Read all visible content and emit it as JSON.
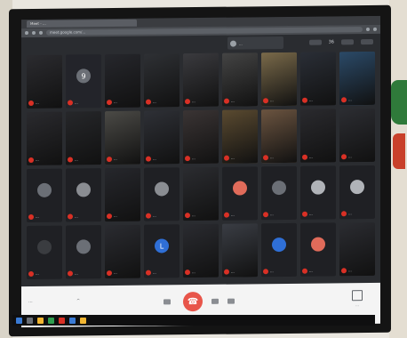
{
  "browser": {
    "tab_label": "Meet - ...",
    "url": "meet.google.com/..."
  },
  "header": {
    "participant_count": "36"
  },
  "presenter": {
    "label": "..."
  },
  "tiles": [
    {
      "name": "...",
      "kind": "cam",
      "bg": "#2b2b2f"
    },
    {
      "name": "...",
      "kind": "avatar",
      "bg": "#23242a",
      "avatar_color": "#6b6f76",
      "initial": "9"
    },
    {
      "name": "...",
      "kind": "cam",
      "bg": "#26272c"
    },
    {
      "name": "...",
      "kind": "cam",
      "bg": "#2e3034"
    },
    {
      "name": "...",
      "kind": "cam",
      "bg": "#3a3a3e"
    },
    {
      "name": "...",
      "kind": "cam",
      "bg": "#444"
    },
    {
      "name": "...",
      "kind": "cam",
      "bg": "#7a6a4a"
    },
    {
      "name": "...",
      "kind": "cam",
      "bg": "#2a2e36"
    },
    {
      "name": "...",
      "kind": "cam",
      "bg": "#2b4a68"
    },
    {
      "name": "...",
      "kind": "cam",
      "bg": "#2a2a2e"
    },
    {
      "name": "...",
      "kind": "cam",
      "bg": "#26272a"
    },
    {
      "name": "...",
      "kind": "cam",
      "bg": "#4b4a46"
    },
    {
      "name": "...",
      "kind": "cam",
      "bg": "#2e3036"
    },
    {
      "name": "...",
      "kind": "cam",
      "bg": "#3a3434"
    },
    {
      "name": "...",
      "kind": "cam",
      "bg": "#5a4a30"
    },
    {
      "name": "...",
      "kind": "cam",
      "bg": "#6b5440"
    },
    {
      "name": "...",
      "kind": "cam",
      "bg": "#2a2a2e"
    },
    {
      "name": "...",
      "kind": "cam",
      "bg": "#2c2d32"
    },
    {
      "name": "...",
      "kind": "avatar",
      "bg": "#1f2024",
      "avatar_color": "#6b6f76",
      "initial": ""
    },
    {
      "name": "...",
      "kind": "avatar",
      "bg": "#1f2024",
      "avatar_color": "#8a8d92",
      "initial": ""
    },
    {
      "name": "...",
      "kind": "cam",
      "bg": "#26272c"
    },
    {
      "name": "...",
      "kind": "avatar",
      "bg": "#1f2024",
      "avatar_color": "#8a8d92",
      "initial": ""
    },
    {
      "name": "...",
      "kind": "cam",
      "bg": "#2b2c30"
    },
    {
      "name": "...",
      "kind": "avatar",
      "bg": "#1f2024",
      "avatar_color": "#e06b5a",
      "initial": ""
    },
    {
      "name": "...",
      "kind": "avatar",
      "bg": "#1f2024",
      "avatar_color": "#6b6f76",
      "initial": ""
    },
    {
      "name": "...",
      "kind": "avatar",
      "bg": "#1f2024",
      "avatar_color": "#b0b3b8",
      "initial": ""
    },
    {
      "name": "...",
      "kind": "avatar",
      "bg": "#1f2024",
      "avatar_color": "#b0b3b8",
      "initial": ""
    },
    {
      "name": "...",
      "kind": "avatar",
      "bg": "#1f2024",
      "avatar_color": "#3a3c40",
      "initial": ""
    },
    {
      "name": "...",
      "kind": "avatar",
      "bg": "#1f2024",
      "avatar_color": "#6b6f76",
      "initial": ""
    },
    {
      "name": "...",
      "kind": "cam",
      "bg": "#2a2b30"
    },
    {
      "name": "...",
      "kind": "avatar",
      "bg": "#1f2024",
      "avatar_color": "#2f6fd6",
      "initial": "L"
    },
    {
      "name": "...",
      "kind": "cam",
      "bg": "#2a2b30"
    },
    {
      "name": "...",
      "kind": "cam",
      "bg": "#3a3d44"
    },
    {
      "name": "...",
      "kind": "avatar",
      "bg": "#1f2024",
      "avatar_color": "#2f6fd6",
      "initial": ""
    },
    {
      "name": "...",
      "kind": "avatar",
      "bg": "#1f2024",
      "avatar_color": "#e06b5a",
      "initial": ""
    },
    {
      "name": "...",
      "kind": "cam",
      "bg": "#2b2c31"
    }
  ],
  "bottombar": {
    "meeting_details": "...",
    "present_label": "..."
  },
  "colors": {
    "hangup": "#e8554a",
    "mic_off": "#d93025"
  }
}
